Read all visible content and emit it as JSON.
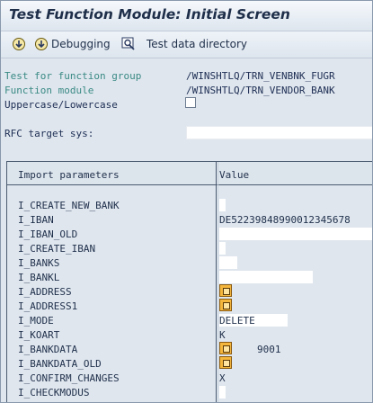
{
  "window": {
    "title": "Test Function Module: Initial Screen"
  },
  "toolbar": {
    "execute_label": "",
    "debugging_label": "Debugging",
    "test_data_label": "Test data directory"
  },
  "header_fields": {
    "function_group_label": "Test for function group",
    "function_group_value": "/WINSHTLQ/TRN_VENBNK_FUGR",
    "function_module_label": "Function module",
    "function_module_value": "/WINSHTLQ/TRN_VENDOR_BANK",
    "uppercase_label": "Uppercase/Lowercase",
    "rfc_label": "RFC target sys:"
  },
  "table": {
    "col_params": "Import parameters",
    "col_value": "Value",
    "rows": [
      {
        "name": "I_CREATE_NEW_BANK",
        "value": ""
      },
      {
        "name": "I_IBAN",
        "value": "DE52239848990012345678"
      },
      {
        "name": "I_IBAN_OLD",
        "value": ""
      },
      {
        "name": "I_CREATE_IBAN",
        "value": ""
      },
      {
        "name": "I_BANKS",
        "value": ""
      },
      {
        "name": "I_BANKL",
        "value": ""
      },
      {
        "name": "I_ADDRESS",
        "value": ""
      },
      {
        "name": "I_ADDRESS1",
        "value": ""
      },
      {
        "name": "I_MODE",
        "value": "DELETE"
      },
      {
        "name": "I_KOART",
        "value": "K"
      },
      {
        "name": "I_BANKDATA",
        "value": "9001"
      },
      {
        "name": "I_BANKDATA_OLD",
        "value": ""
      },
      {
        "name": "I_CONFIRM_CHANGES",
        "value": "X"
      },
      {
        "name": "I_CHECKMODUS",
        "value": ""
      }
    ]
  },
  "colors": {
    "label_teal": "#3a8a84",
    "text_dark": "#203055",
    "background": "#dfe6ee",
    "struct_icon": "#f4b63c"
  }
}
